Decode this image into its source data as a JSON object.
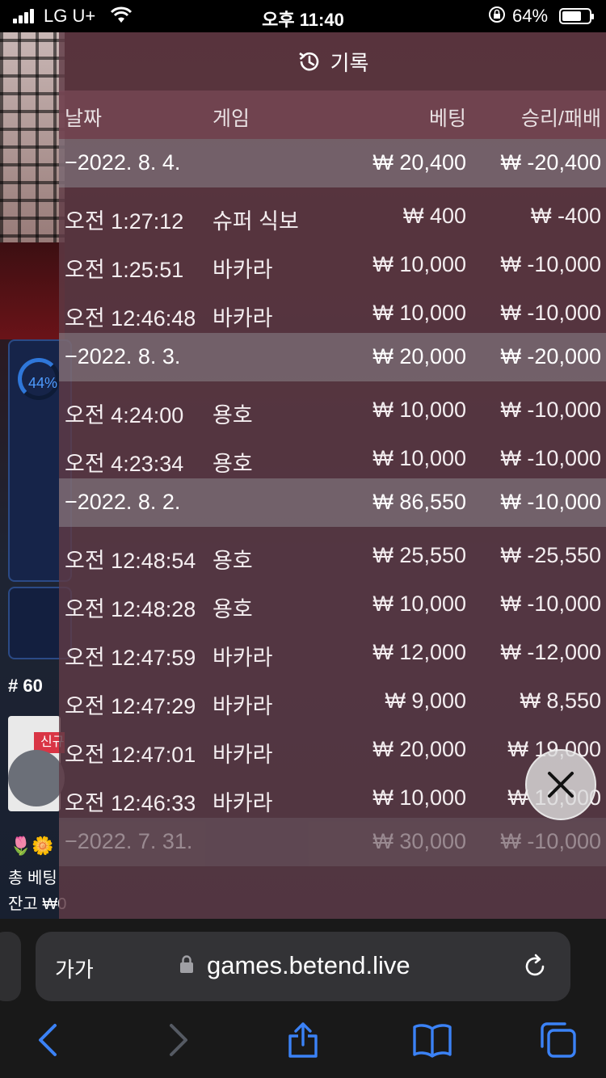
{
  "status_bar": {
    "carrier": "LG U+",
    "time": "오후 11:40",
    "battery": "64%"
  },
  "background": {
    "progress_percent": "44%",
    "round_number": "# 60",
    "new_tag": "신규",
    "total_bet_label": "총 베팅",
    "balance_label": "잔고 ₩0"
  },
  "history": {
    "title": "기록",
    "columns": {
      "date": "날짜",
      "game": "게임",
      "bet": "베팅",
      "result": "승리/패배"
    },
    "days": [
      {
        "date": "−2022. 8. 4.",
        "bet": "₩ 20,400",
        "result": "₩ -20,400",
        "rows": [
          {
            "time": "오전 1:27:12",
            "game": "슈퍼 식보",
            "bet": "₩ 400",
            "result": "₩ -400"
          },
          {
            "time": "오전 1:25:51",
            "game": "바카라",
            "bet": "₩ 10,000",
            "result": "₩ -10,000"
          },
          {
            "time": "오전 12:46:48",
            "game": "바카라",
            "bet": "₩ 10,000",
            "result": "₩ -10,000"
          }
        ]
      },
      {
        "date": "−2022. 8. 3.",
        "bet": "₩ 20,000",
        "result": "₩ -20,000",
        "rows": [
          {
            "time": "오전 4:24:00",
            "game": "용호",
            "bet": "₩ 10,000",
            "result": "₩ -10,000"
          },
          {
            "time": "오전 4:23:34",
            "game": "용호",
            "bet": "₩ 10,000",
            "result": "₩ -10,000"
          }
        ]
      },
      {
        "date": "−2022. 8. 2.",
        "bet": "₩ 86,550",
        "result": "₩ -10,000",
        "rows": [
          {
            "time": "오전 12:48:54",
            "game": "용호",
            "bet": "₩ 25,550",
            "result": "₩ -25,550"
          },
          {
            "time": "오전 12:48:28",
            "game": "용호",
            "bet": "₩ 10,000",
            "result": "₩ -10,000"
          },
          {
            "time": "오전 12:47:59",
            "game": "바카라",
            "bet": "₩ 12,000",
            "result": "₩ -12,000"
          },
          {
            "time": "오전 12:47:29",
            "game": "바카라",
            "bet": "₩ 9,000",
            "result": "₩ 8,550"
          },
          {
            "time": "오전 12:47:01",
            "game": "바카라",
            "bet": "₩ 20,000",
            "result": "₩ 19,000"
          },
          {
            "time": "오전 12:46:33",
            "game": "바카라",
            "bet": "₩ 10,000",
            "result": "₩ 10,000"
          }
        ]
      },
      {
        "date": "−2022. 7. 31.",
        "bet": "₩ 30,000",
        "result": "₩ -10,000",
        "rows": []
      }
    ]
  },
  "browser": {
    "text_size_label": "가가",
    "url": "games.betend.live"
  },
  "colors": {
    "accent_blue": "#3b82f6",
    "overlay": "#5f3a46"
  }
}
